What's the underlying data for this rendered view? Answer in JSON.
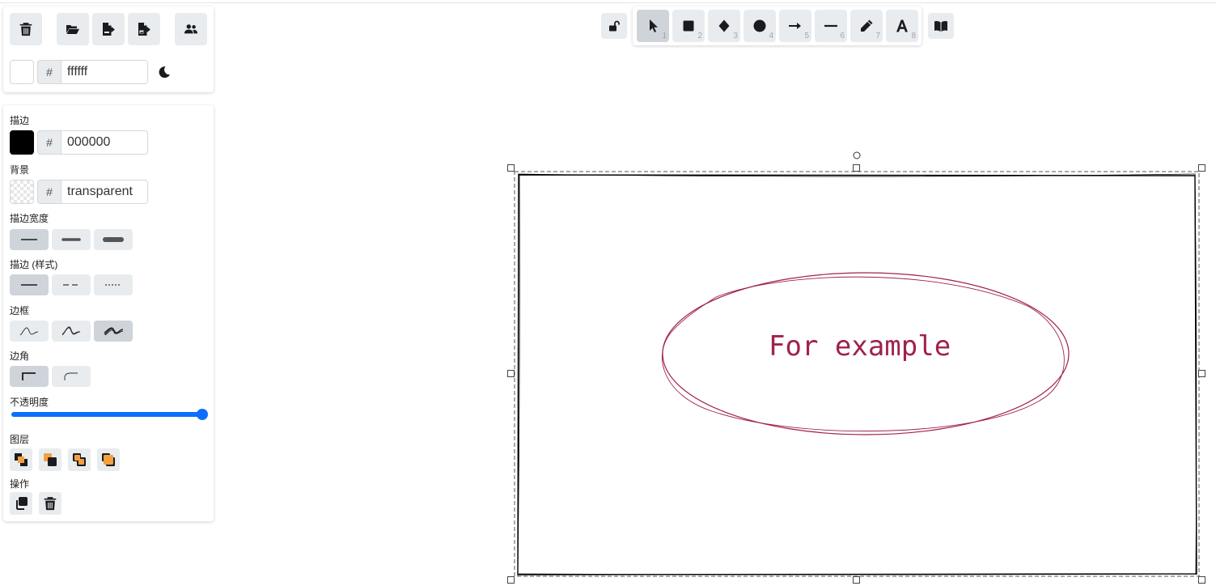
{
  "app_menu": {
    "buttons": [
      {
        "name": "clear-canvas-button",
        "icon": "trash-icon"
      },
      {
        "name": "open-file-button",
        "icon": "folder-open-icon"
      },
      {
        "name": "save-file-button",
        "icon": "file-export-icon"
      },
      {
        "name": "export-image-button",
        "icon": "file-image-export-icon"
      },
      {
        "name": "collaborate-button",
        "icon": "users-icon"
      }
    ],
    "canvas_background": {
      "hash": "#",
      "value": "ffffff",
      "swatch_color": "#ffffff"
    },
    "theme_toggle_icon": "moon-icon"
  },
  "properties": {
    "stroke": {
      "label": "描边",
      "hash": "#",
      "value": "000000",
      "swatch_color": "#000000"
    },
    "background": {
      "label": "背景",
      "hash": "#",
      "value": "transparent"
    },
    "stroke_width": {
      "label": "描边宽度",
      "options": [
        "thin",
        "bold",
        "extra-bold"
      ],
      "selected": "thin"
    },
    "stroke_style": {
      "label": "描边 (样式)",
      "options": [
        "solid",
        "dashed",
        "dotted"
      ],
      "selected": "solid"
    },
    "sloppiness": {
      "label": "边框",
      "options": [
        "architect",
        "artist",
        "cartoonist"
      ],
      "selected": "cartoonist"
    },
    "edges": {
      "label": "边角",
      "options": [
        "sharp",
        "round"
      ],
      "selected": "sharp"
    },
    "opacity": {
      "label": "不透明度",
      "value": 100,
      "max": 100
    },
    "layers": {
      "label": "图层",
      "buttons": [
        "send-to-back-icon",
        "send-backward-icon",
        "bring-forward-icon",
        "bring-to-front-icon"
      ]
    },
    "actions": {
      "label": "操作",
      "buttons": [
        "duplicate-icon",
        "delete-icon"
      ]
    }
  },
  "toolbar": {
    "lock_icon": "lock-open-icon",
    "tools": [
      {
        "name": "selection",
        "icon": "cursor-icon",
        "shortcut": "1",
        "active": true
      },
      {
        "name": "rectangle",
        "icon": "square-icon",
        "shortcut": "2",
        "active": false
      },
      {
        "name": "diamond",
        "icon": "diamond-icon",
        "shortcut": "3",
        "active": false
      },
      {
        "name": "ellipse",
        "icon": "circle-icon",
        "shortcut": "4",
        "active": false
      },
      {
        "name": "arrow",
        "icon": "arrow-right-icon",
        "shortcut": "5",
        "active": false
      },
      {
        "name": "line",
        "icon": "line-icon",
        "shortcut": "6",
        "active": false
      },
      {
        "name": "draw",
        "icon": "pencil-icon",
        "shortcut": "7",
        "active": false
      },
      {
        "name": "text",
        "icon": "text-icon",
        "shortcut": "8",
        "active": false
      }
    ],
    "library_icon": "book-open-icon"
  },
  "canvas": {
    "text": "For example",
    "text_color": "#a0214e",
    "ellipse_color": "#a0214e",
    "rect_color": "#000000"
  }
}
